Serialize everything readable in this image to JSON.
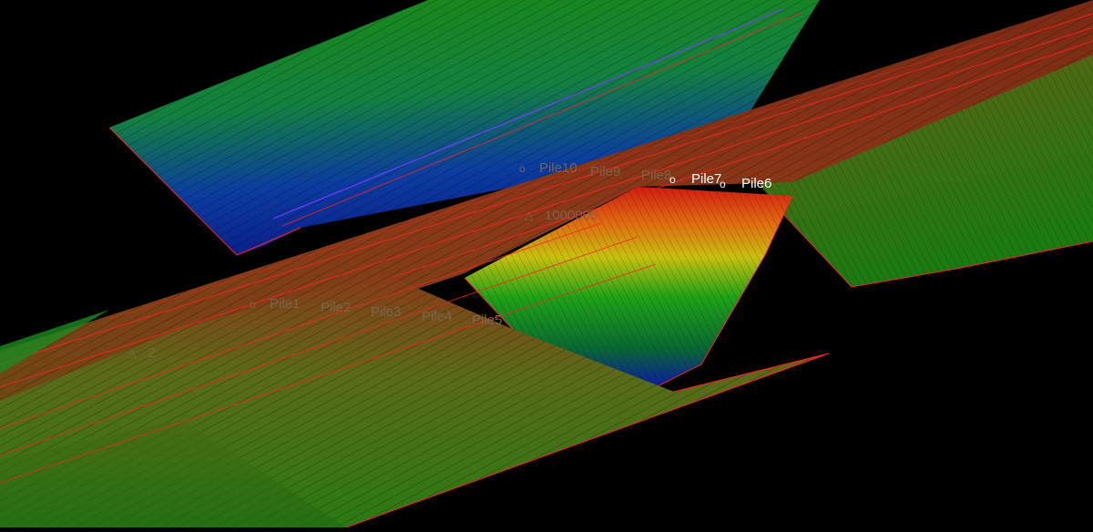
{
  "pile_labels": {
    "p1": "Pile1",
    "p2": "Pile2",
    "p3": "Pile3",
    "p4": "Pile4",
    "p5": "Pile5",
    "p6": "Pile6",
    "p7": "Pile7",
    "p8": "Pile8",
    "p9": "Pile9",
    "p10": "Pile10"
  },
  "survey_labels": {
    "point_a": "1000005",
    "point_b": "2"
  },
  "colors": {
    "background": "#000000",
    "edge_outline": "#ff2020",
    "wireframe": "#000000",
    "ramp_high": "#c43a1a",
    "ramp_mid": "#1f9a18",
    "ramp_low": "#0a1ea0"
  },
  "icons": {
    "pile_marker": "circle-marker-icon",
    "survey_marker": "triangle-marker-icon"
  }
}
